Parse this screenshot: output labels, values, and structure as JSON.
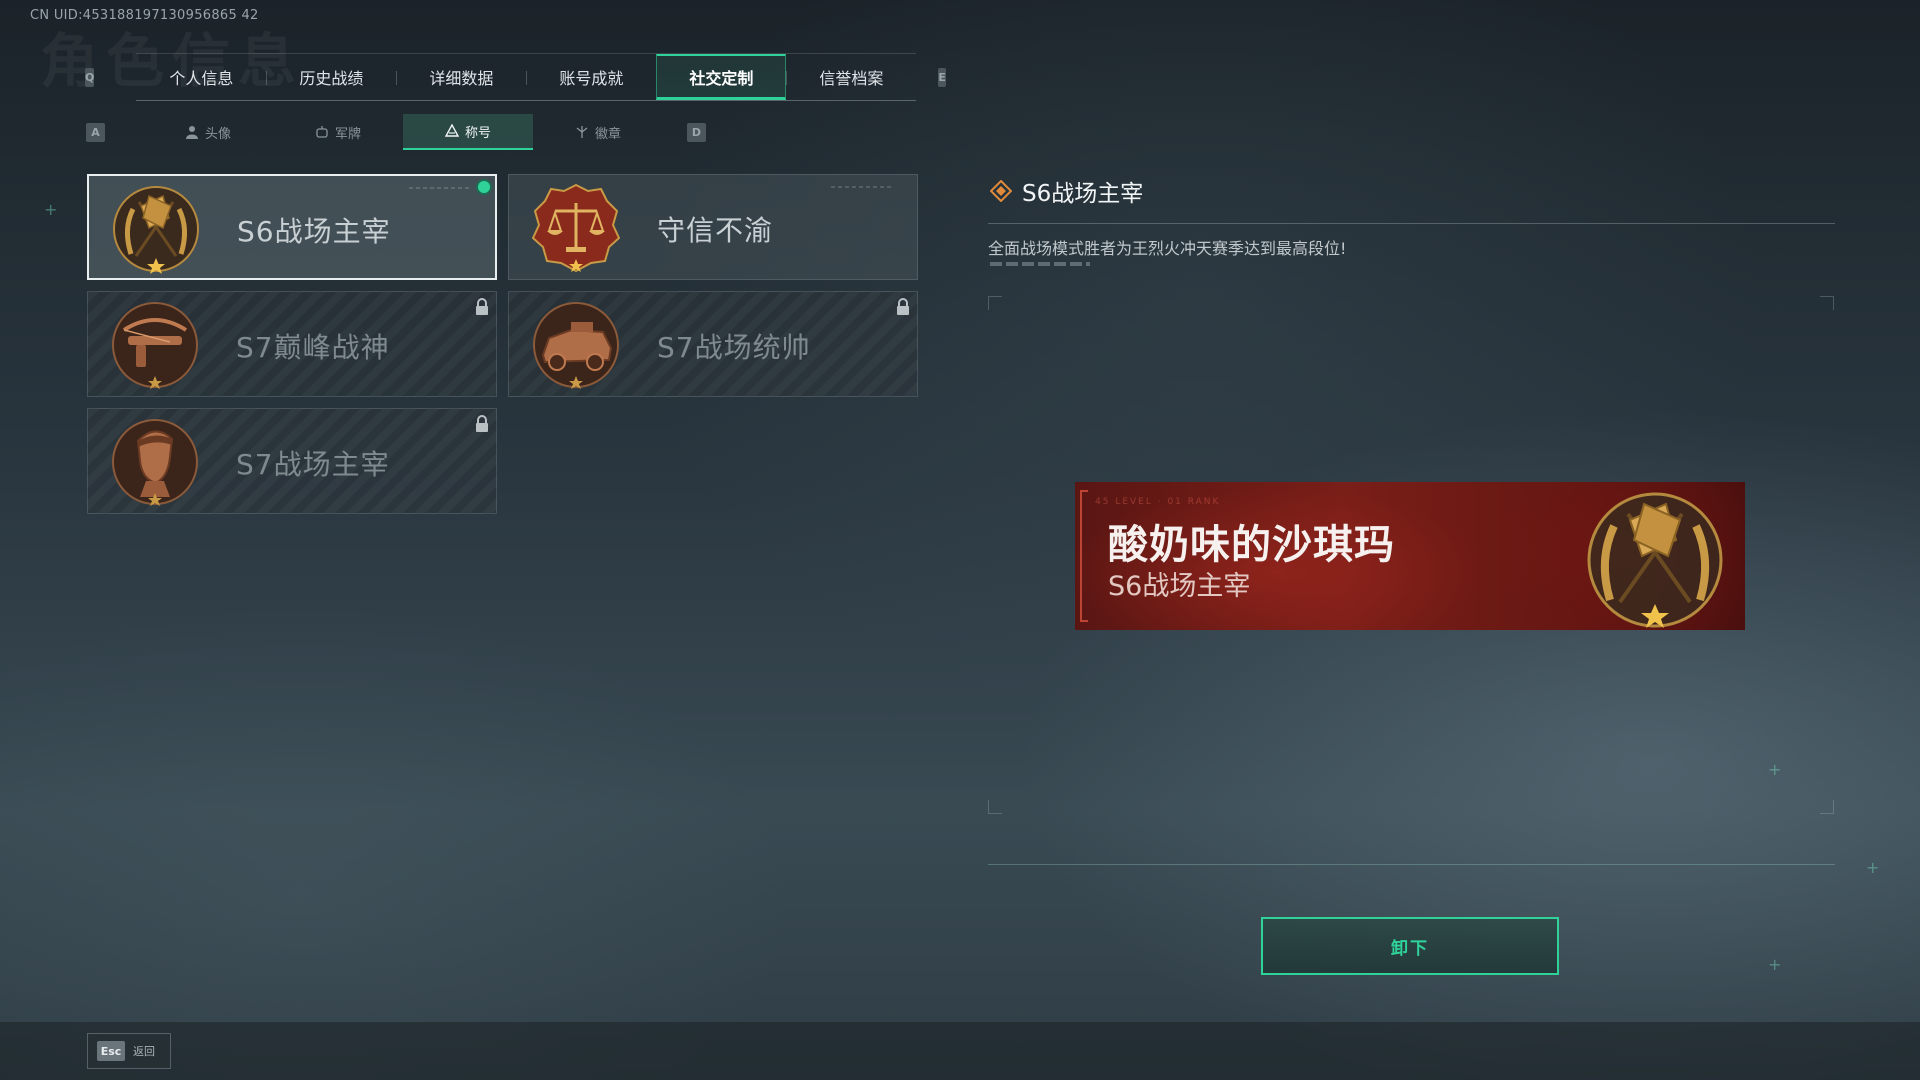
{
  "uid": "CN UID:453188197130956865 42",
  "ghost_title": "角色信息",
  "main_tabs": {
    "left_key": "Q",
    "right_key": "E",
    "items": [
      "个人信息",
      "历史战绩",
      "详细数据",
      "账号成就",
      "社交定制",
      "信誉档案"
    ],
    "active": "社交定制"
  },
  "sub_tabs": {
    "left_key": "A",
    "right_key": "D",
    "items": [
      {
        "label": "头像",
        "icon": "person-icon"
      },
      {
        "label": "军牌",
        "icon": "dogtag-icon"
      },
      {
        "label": "称号",
        "icon": "triangle-icon"
      },
      {
        "label": "徽章",
        "icon": "badge-icon"
      }
    ],
    "active": "称号"
  },
  "titles": [
    {
      "label": "S6战场主宰",
      "emblem": "crossed-flags-emblem-icon",
      "state": "equipped"
    },
    {
      "label": "守信不渝",
      "emblem": "scales-emblem-icon",
      "state": "owned"
    },
    {
      "label": "S7巅峰战神",
      "emblem": "crossbow-emblem-icon",
      "state": "locked"
    },
    {
      "label": "S7战场统帅",
      "emblem": "armored-vehicle-emblem-icon",
      "state": "locked"
    },
    {
      "label": "S7战场主宰",
      "emblem": "soldier-portrait-emblem-icon",
      "state": "locked"
    }
  ],
  "detail": {
    "name": "S6战场主宰",
    "description": "全面战场模式胜者为王烈火冲天赛季达到最高段位!"
  },
  "preview": {
    "meta": "45 LEVEL · 01 RANK",
    "player_name": "酸奶味的沙琪玛",
    "title": "S6战场主宰"
  },
  "actions": {
    "unequip": "卸下",
    "esc_key": "Esc",
    "back": "返回"
  },
  "colors": {
    "accent": "#2fd39a",
    "preview_red": "#7a1e18",
    "emblem_gold": "#c99a45"
  }
}
